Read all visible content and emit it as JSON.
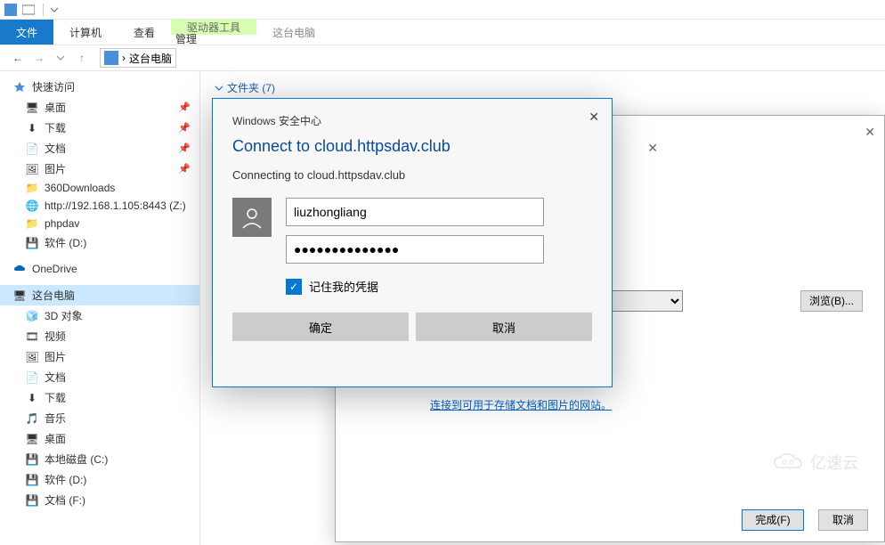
{
  "titlebar": {},
  "ribbon": {
    "file": "文件",
    "computer": "计算机",
    "view": "查看",
    "drive_tools": "驱动器工具",
    "manage": "管理",
    "this_pc": "这台电脑"
  },
  "breadcrumb": {
    "location": "这台电脑",
    "sep": "›"
  },
  "sidebar": {
    "quick_access": "快速访问",
    "qa_items": [
      {
        "label": "桌面",
        "icon": "desktop"
      },
      {
        "label": "下载",
        "icon": "download"
      },
      {
        "label": "文档",
        "icon": "document"
      },
      {
        "label": "图片",
        "icon": "picture"
      },
      {
        "label": "360Downloads",
        "icon": "folder"
      },
      {
        "label": "http://192.168.1.105:8443 (Z:)",
        "icon": "netdrive"
      },
      {
        "label": "phpdav",
        "icon": "folder"
      },
      {
        "label": "软件 (D:)",
        "icon": "drive"
      }
    ],
    "onedrive": "OneDrive",
    "this_pc": "这台电脑",
    "pc_items": [
      {
        "label": "3D 对象",
        "icon": "3d"
      },
      {
        "label": "视频",
        "icon": "video"
      },
      {
        "label": "图片",
        "icon": "picture"
      },
      {
        "label": "文档",
        "icon": "document"
      },
      {
        "label": "下载",
        "icon": "download"
      },
      {
        "label": "音乐",
        "icon": "music"
      },
      {
        "label": "桌面",
        "icon": "desktop"
      },
      {
        "label": "本地磁盘 (C:)",
        "icon": "drive"
      },
      {
        "label": "软件 (D:)",
        "icon": "drive"
      },
      {
        "label": "文档 (F:)",
        "icon": "drive"
      }
    ]
  },
  "content": {
    "folder_header": "文件夹 (7)"
  },
  "bg_dialog": {
    "browse": "浏览(B)...",
    "link_text": "连接到可用于存储文档和图片的网站",
    "done": "完成(F)",
    "cancel": "取消"
  },
  "cred_dialog": {
    "title": "Windows 安全中心",
    "heading": "Connect to cloud.httpsdav.club",
    "subheading": "Connecting to cloud.httpsdav.club",
    "username": "liuzhongliang",
    "password_mask": "●●●●●●●●●●●●●●",
    "remember": "记住我的凭据",
    "ok": "确定",
    "cancel": "取消"
  },
  "watermark": "亿速云"
}
